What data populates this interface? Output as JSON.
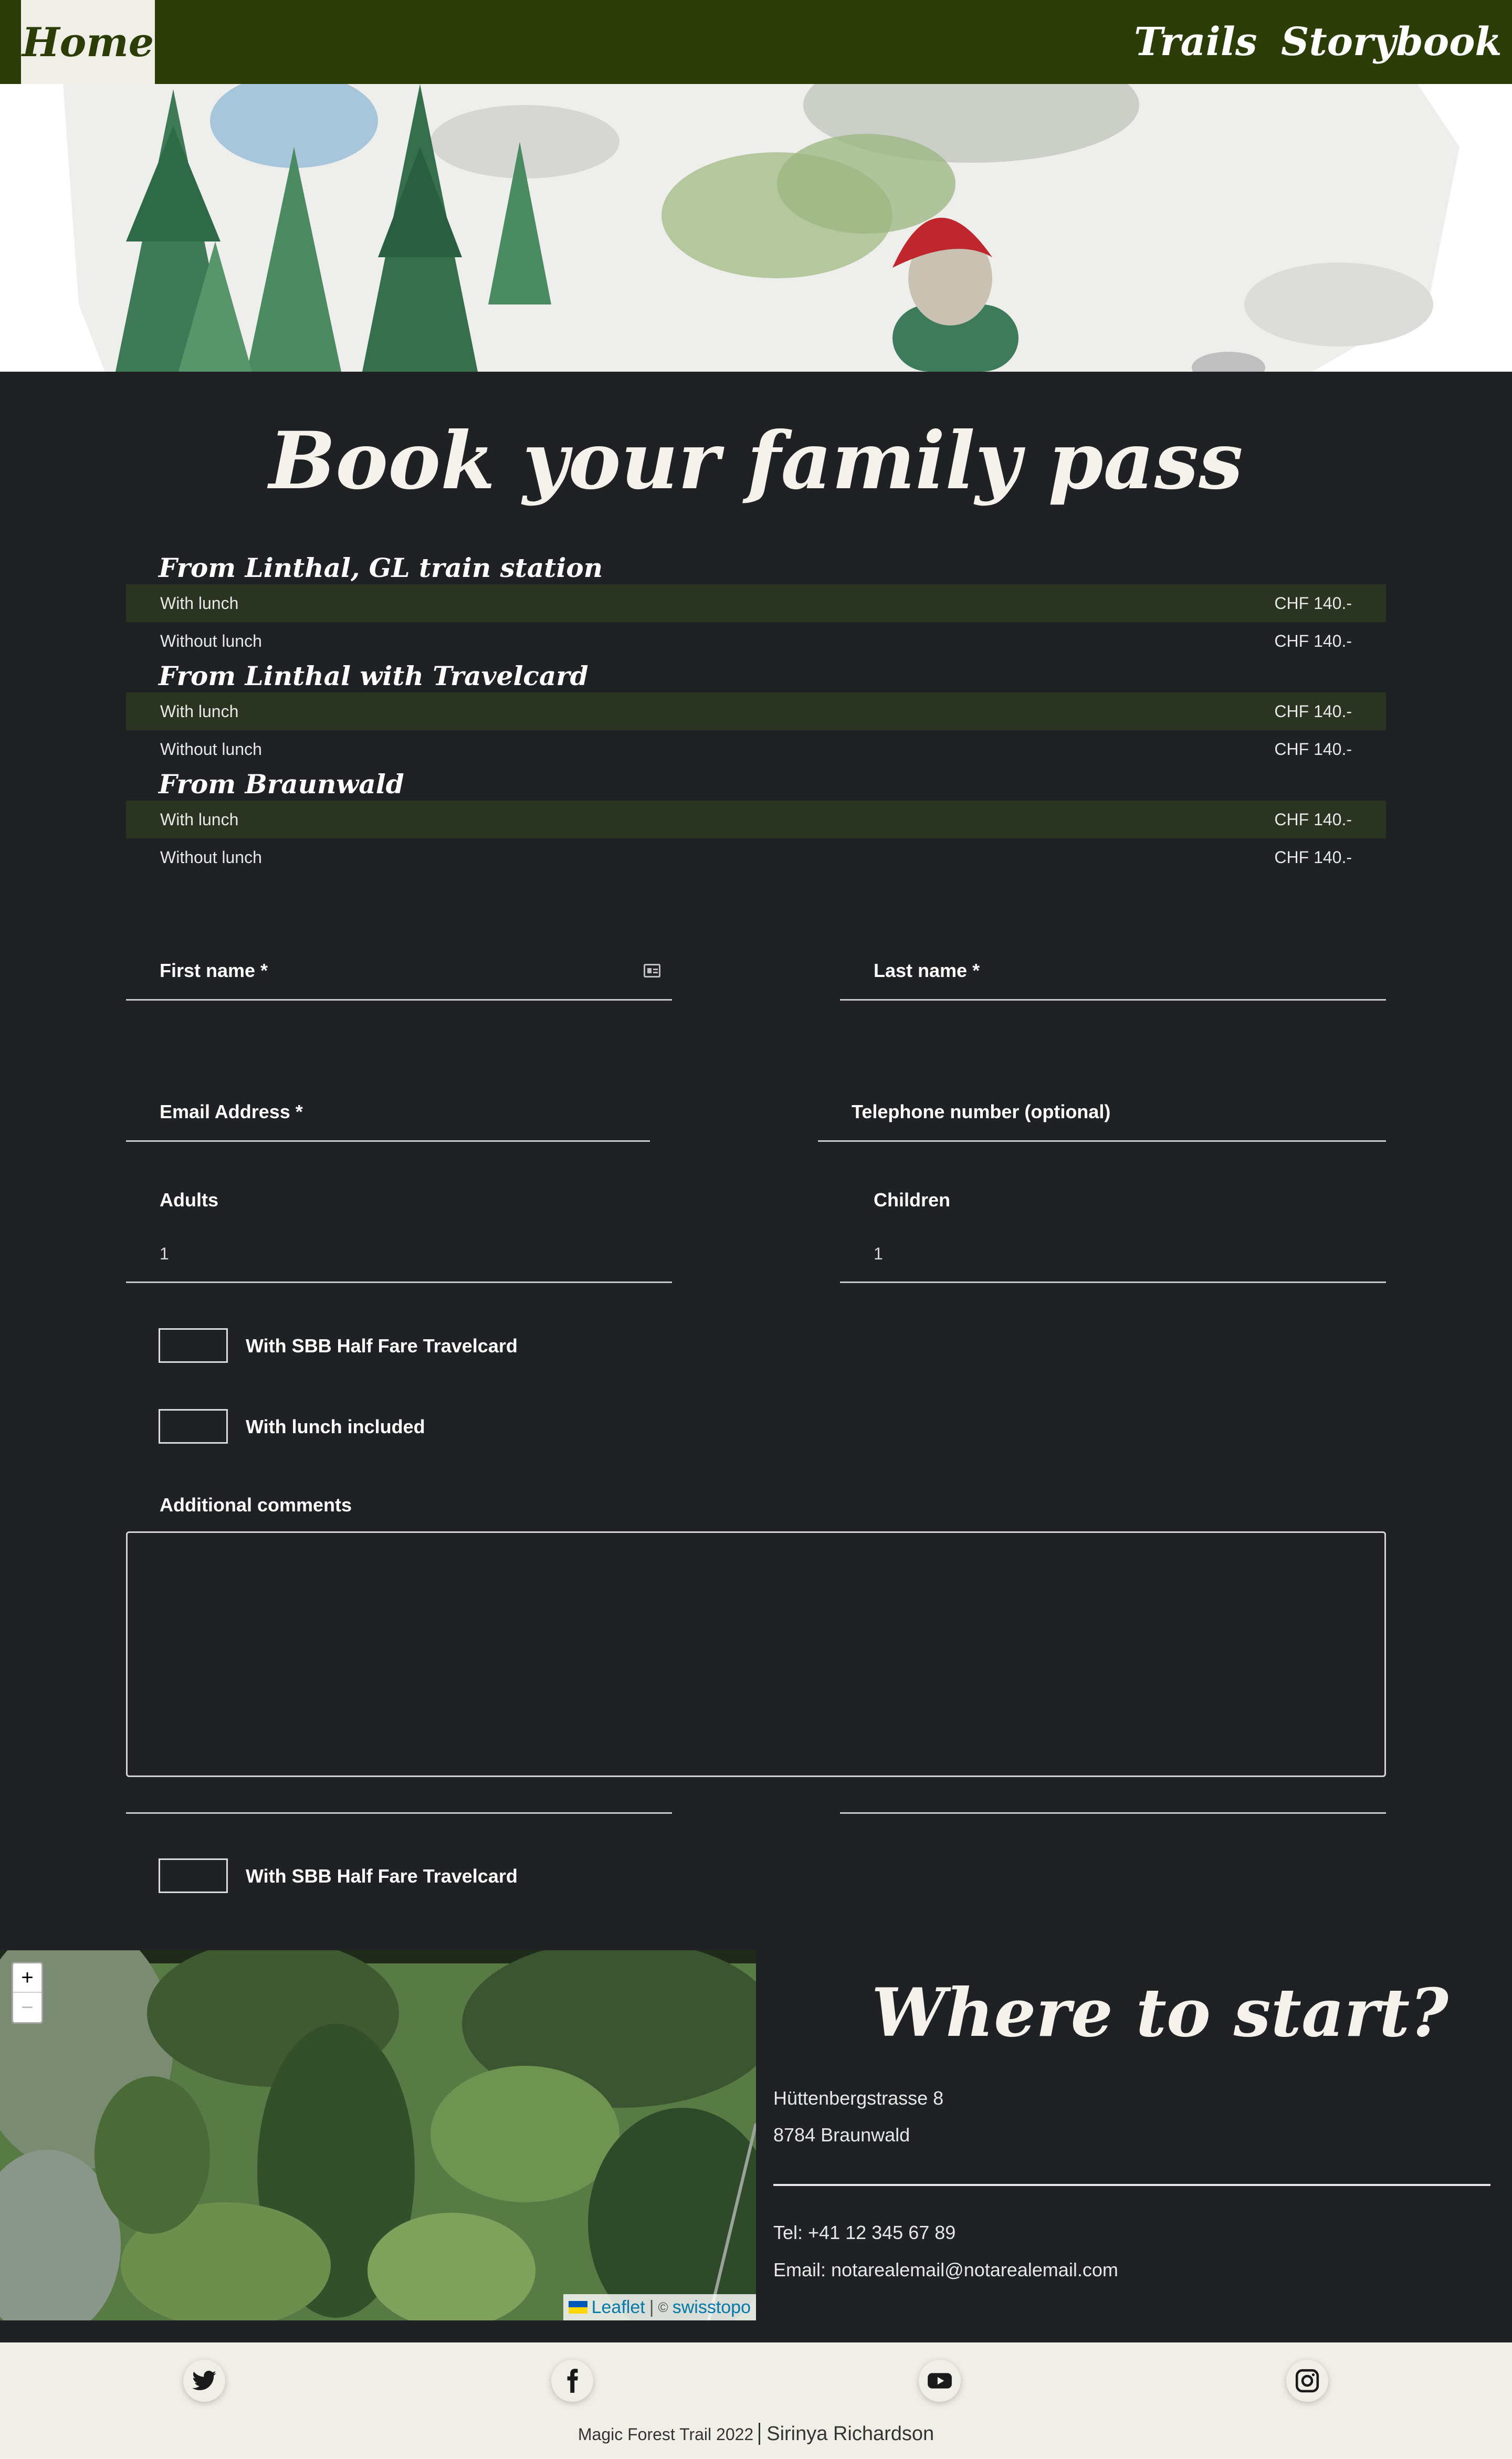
{
  "nav": {
    "home": "Home",
    "trails": "Trails",
    "storybook": "Storybook"
  },
  "booking": {
    "title": "Book your family pass",
    "sections": [
      {
        "title": "From Linthal, GL train station",
        "rows": [
          {
            "label": "With lunch",
            "price": "CHF 140.-"
          },
          {
            "label": "Without lunch",
            "price": "CHF 140.-"
          }
        ]
      },
      {
        "title": "From Linthal with Travelcard",
        "rows": [
          {
            "label": "With lunch",
            "price": "CHF 140.-"
          },
          {
            "label": "Without lunch",
            "price": "CHF 140.-"
          }
        ]
      },
      {
        "title": "From Braunwald",
        "rows": [
          {
            "label": "With lunch",
            "price": "CHF 140.-"
          },
          {
            "label": "Without lunch",
            "price": "CHF 140.-"
          }
        ]
      }
    ]
  },
  "form": {
    "first_name_label": "First name *",
    "last_name_label": "Last name *",
    "email_label": "Email Address *",
    "phone_label": "Telephone number (optional)",
    "adults_label": "Adults",
    "adults_value": "1",
    "children_label": "Children",
    "children_value": "1",
    "halffare_label": "With SBB Half Fare Travelcard",
    "lunch_label": "With lunch included",
    "comments_label": "Additional comments",
    "halffare_label_2": "With SBB Half Fare Travelcard"
  },
  "map": {
    "zoom_in": "+",
    "zoom_out": "−",
    "leaflet": "Leaflet",
    "separator": "|",
    "copy": "©",
    "provider": "swisstopo"
  },
  "where": {
    "title": "Where to start?",
    "street": "Hüttenbergstrasse 8",
    "city": "8784 Braunwald",
    "tel": "Tel: +41 12 345 67 89",
    "email": "Email: notarealemail@notarealemail.com"
  },
  "footer": {
    "copyright": "Magic Forest Trail 2022",
    "author": "Sirinya Richardson"
  },
  "icons": [
    "twitter-icon",
    "facebook-icon",
    "youtube-icon",
    "instagram-icon",
    "card-icon"
  ]
}
